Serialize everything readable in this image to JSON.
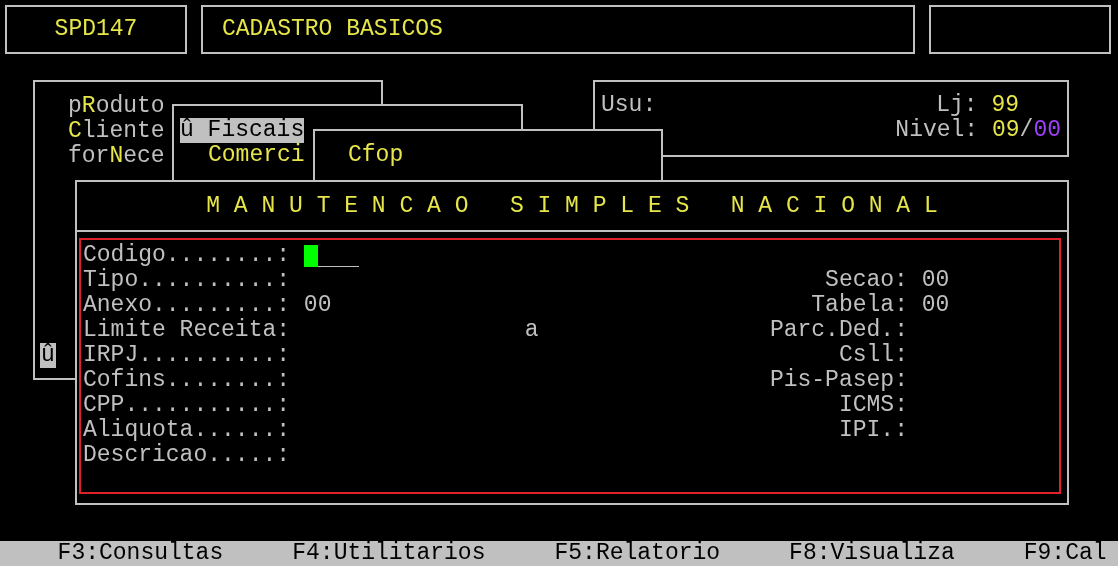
{
  "header": {
    "program": "SPD147",
    "title": "CADASTRO BASICOS"
  },
  "menu": {
    "items": [
      {
        "before": "p",
        "key": "R",
        "after": "oduto"
      },
      {
        "key": "C",
        "after": "liente"
      },
      {
        "before": "for",
        "key": "N",
        "after": "ece"
      }
    ],
    "marker": "û"
  },
  "submenus": [
    {
      "items": [
        {
          "label": "û Fiscais",
          "selected": true
        },
        {
          "label": "Comerci",
          "selected": false
        }
      ]
    },
    {
      "items": [
        {
          "label": "Cfop",
          "selected": false
        }
      ]
    }
  ],
  "user_panel": {
    "user_label": "Usu:",
    "store_label": "Lj:",
    "store": "99",
    "level_label": "Nivel:",
    "level_value": "09",
    "level_separator": "/",
    "level_limit": "00"
  },
  "form": {
    "title": "M A N U T E N C A O   S I M P L E S   N A C I O N A L",
    "rows": [
      {
        "left": {
          "label": "Codigo........:",
          "kind": "input"
        }
      },
      {
        "left": {
          "label": "Tipo..........:",
          "kind": "text"
        },
        "right": {
          "label": "Secao:",
          "value": "00"
        }
      },
      {
        "left": {
          "label": "Anexo.........:",
          "kind": "text",
          "value": "00"
        },
        "right": {
          "label": "Tabela:",
          "value": "00"
        }
      },
      {
        "left": {
          "label": "Limite Receita:",
          "kind": "text"
        },
        "separator": "a",
        "right": {
          "label": "Parc.Ded.:"
        }
      },
      {
        "left": {
          "label": "IRPJ..........:",
          "kind": "text"
        },
        "right": {
          "label": "Csll:"
        }
      },
      {
        "left": {
          "label": "Cofins........:",
          "kind": "text"
        },
        "right": {
          "label": "Pis-Pasep:"
        }
      },
      {
        "left": {
          "label": "CPP...........:",
          "kind": "text"
        },
        "right": {
          "label": "ICMS:"
        }
      },
      {
        "left": {
          "label": "Aliquota......:",
          "kind": "text"
        },
        "right": {
          "label": "IPI.:"
        }
      },
      {
        "left": {
          "label": "Descricao.....:",
          "kind": "text"
        }
      }
    ]
  },
  "status_bar": [
    "F3:Consultas",
    "F4:Utilitarios",
    "F5:Relatorio",
    "F8:Visualiza",
    "F9:Cal"
  ]
}
